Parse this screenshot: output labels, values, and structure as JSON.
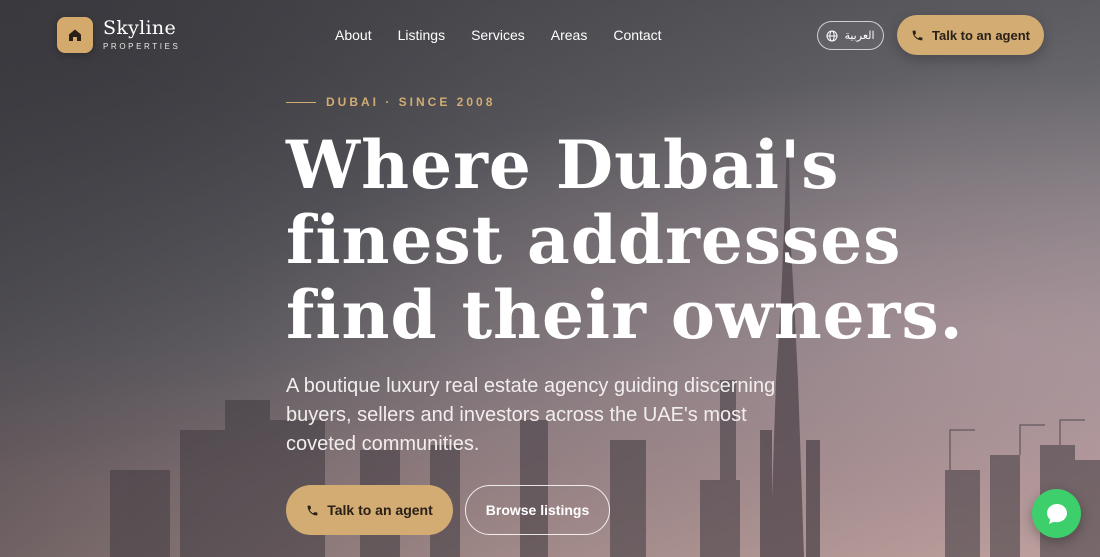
{
  "brand": {
    "name": "Skyline",
    "tagline": "PROPERTIES",
    "logo_icon": "home-icon"
  },
  "nav": {
    "items": [
      {
        "label": "About"
      },
      {
        "label": "Listings"
      },
      {
        "label": "Services"
      },
      {
        "label": "Areas"
      },
      {
        "label": "Contact"
      }
    ]
  },
  "header": {
    "language_label": "العربية",
    "language_icon": "globe-icon",
    "agent_button_label": "Talk to an agent",
    "agent_button_icon": "phone-icon"
  },
  "hero": {
    "eyebrow": "DUBAI · SINCE 2008",
    "title_lines": [
      "Where Dubai's",
      "finest addresses",
      "find their owners."
    ],
    "subtitle": "A boutique luxury real estate agency guiding discerning buyers, sellers and investors across the UAE's most coveted communities.",
    "primary_cta": "Talk to an agent",
    "secondary_cta": "Browse listings"
  },
  "chat": {
    "icon": "chat-bubble-icon"
  },
  "colors": {
    "accent": "#d2ac73",
    "chat_green": "#3dcf6b",
    "dark_text": "#2a2018"
  }
}
